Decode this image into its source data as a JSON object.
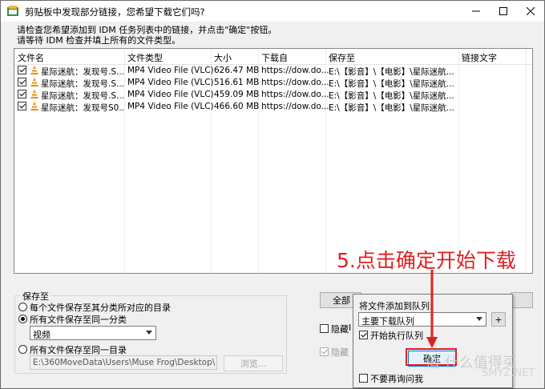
{
  "window": {
    "title": "剪贴板中发现部分链接，您希望下载它们吗?",
    "controls": [
      "minimize-icon",
      "maximize-icon",
      "close-icon"
    ]
  },
  "instructions": {
    "line1": "请检查您希望添加到 IDM 任务列表中的链接，并点击\"确定\"按钮。",
    "line2": "请等待 IDM 检查并填上所有的文件类型。"
  },
  "table": {
    "headers": [
      "文件名",
      "文件类型",
      "大小",
      "下载自",
      "保存至",
      "链接文字"
    ],
    "rows": [
      {
        "name": "星际迷航：发现号.S...",
        "type": "MP4 Video File (VLC)",
        "size": "626.47  MB",
        "from": "https://dow.do...",
        "save": "E:\\【影音】\\【电影】\\星际迷航...",
        "text": ""
      },
      {
        "name": "星际迷航：发现号.S...",
        "type": "MP4 Video File (VLC)",
        "size": "516.61  MB",
        "from": "https://dow.do...",
        "save": "E:\\【影音】\\【电影】\\星际迷航...",
        "text": ""
      },
      {
        "name": "星际迷航：发现号.S...",
        "type": "MP4 Video File (VLC)",
        "size": "459.09  MB",
        "from": "https://dow.do...",
        "save": "E:\\【影音】\\【电影】\\星际迷航...",
        "text": ""
      },
      {
        "name": "星际迷航：发现号S0...",
        "type": "MP4 Video File (VLC)",
        "size": "466.60  MB",
        "from": "https://dow.do...",
        "save": "E:\\【影音】\\【电影】\\星际迷航...",
        "text": ""
      }
    ]
  },
  "save_group": {
    "label": "保存至",
    "option1": "每个文件保存至其分类所对应的目录",
    "option2": "所有文件保存至同一分类",
    "category_value": "视频",
    "option3": "所有文件保存至同一目录",
    "path_value": "E:\\360MoveData\\Users\\Muse Frog\\Desktop\\",
    "browse": "浏览..."
  },
  "bottom": {
    "all_button": "全部",
    "hide1": "隐藏",
    "hide1_suffix": "I",
    "hide2": "隐藏"
  },
  "popup": {
    "queue_label": "将文件添加到队列:",
    "queue_value": "主要下载队列",
    "add_queue": "+",
    "start_queue": "开始执行队列",
    "ok": "确定",
    "no_ask": "不要再询问我"
  },
  "annotation": "5.点击确定开始下载",
  "watermark": "值 什么值得买",
  "watermark2": "SMYZ.NET",
  "colors": {
    "annotation": "#e02020",
    "accent": "#0078d7"
  }
}
